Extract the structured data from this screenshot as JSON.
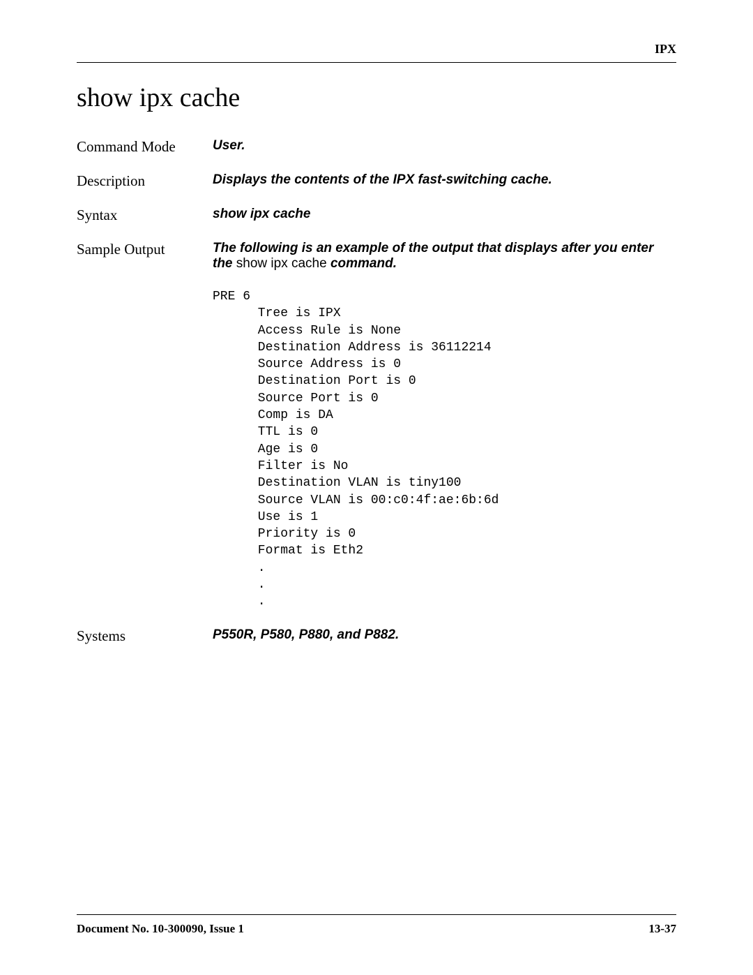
{
  "header": {
    "section_label": "IPX"
  },
  "title": "show ipx cache",
  "sections": {
    "command_mode": {
      "label": "Command Mode",
      "value": "User."
    },
    "description": {
      "label": "Description",
      "value": "Displays the contents of the IPX fast-switching cache."
    },
    "syntax": {
      "label": "Syntax",
      "value": "show ipx cache"
    },
    "sample_output": {
      "label": "Sample Output",
      "intro_prefix": "The following is an example of the output that displays after you enter the ",
      "intro_cmd": "show ipx cache",
      "intro_suffix": " command.",
      "output": "PRE 6\n      Tree is IPX\n      Access Rule is None\n      Destination Address is 36112214\n      Source Address is 0\n      Destination Port is 0\n      Source Port is 0\n      Comp is DA\n      TTL is 0\n      Age is 0\n      Filter is No\n      Destination VLAN is tiny100\n      Source VLAN is 00:c0:4f:ae:6b:6d\n      Use is 1\n      Priority is 0\n      Format is Eth2\n      .\n      .\n      ."
    },
    "systems": {
      "label": "Systems",
      "value": "P550R, P580, P880, and P882."
    }
  },
  "footer": {
    "doc_no": "Document No. 10-300090, Issue 1",
    "page_no": "13-37"
  }
}
